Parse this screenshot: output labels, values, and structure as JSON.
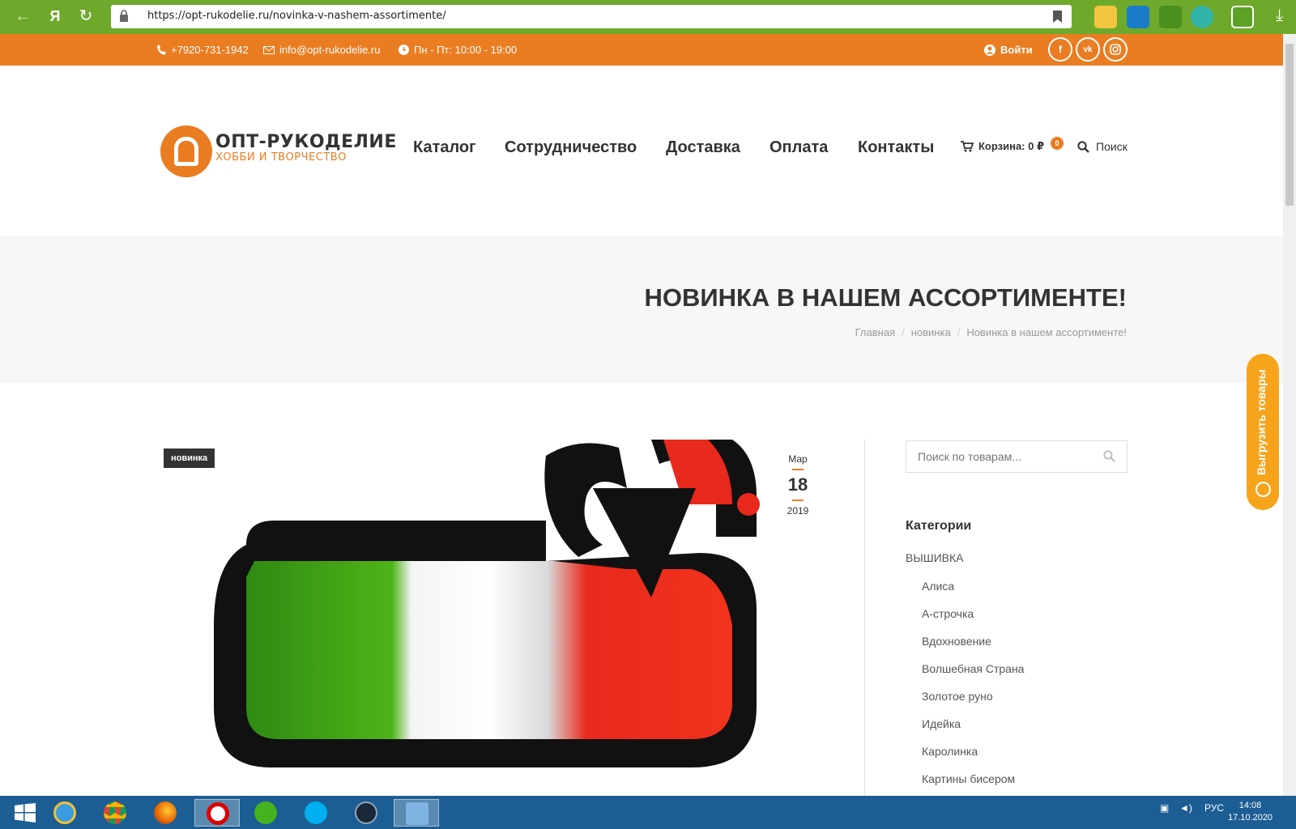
{
  "browser": {
    "url": "https://opt-rukodelie.ru/novinka-v-nashem-assortimente/",
    "yandex_label": "Я"
  },
  "topbar": {
    "phone": "+7920-731-1942",
    "email": "info@opt-rukodelie.ru",
    "hours": "Пн - Пт: 10:00 - 19:00",
    "login": "Войти",
    "social": [
      "f",
      "vk",
      "ig"
    ]
  },
  "header": {
    "logo_title": "ОПТ-РУКОДЕЛИЕ",
    "logo_sub": "ХОББИ И ТВОРЧЕСТВО",
    "menu": [
      "Каталог",
      "Сотрудничество",
      "Доставка",
      "Оплата",
      "Контакты"
    ],
    "cart_label": "Корзина: 0 ₽",
    "cart_count": "0",
    "search_label": "Поиск"
  },
  "page": {
    "title": "НОВИНКА В НАШЕМ АССОРТИМЕНТЕ!",
    "breadcrumb": [
      "Главная",
      "новинка",
      "Новинка в нашем ассортименте!"
    ]
  },
  "post": {
    "tag": "новинка",
    "date_month": "Мар",
    "date_day": "18",
    "date_year": "2019"
  },
  "sidebar": {
    "search_placeholder": "Поиск по товарам...",
    "categories_title": "Категории",
    "root_category": "ВЫШИВКА",
    "subcategories": [
      "Алиса",
      "А-строчка",
      "Вдохновение",
      "Волшебная Страна",
      "Золотое руно",
      "Идейка",
      "Каролинка",
      "Картины бисером"
    ]
  },
  "side_tab": {
    "label": "Выгрузить товары"
  },
  "taskbar": {
    "lang": "РУС",
    "time": "14:08",
    "date": "17.10.2020"
  },
  "colors": {
    "accent": "#ea7d22",
    "browser_green": "#6fa92c",
    "taskbar_blue": "#1c5d93"
  }
}
